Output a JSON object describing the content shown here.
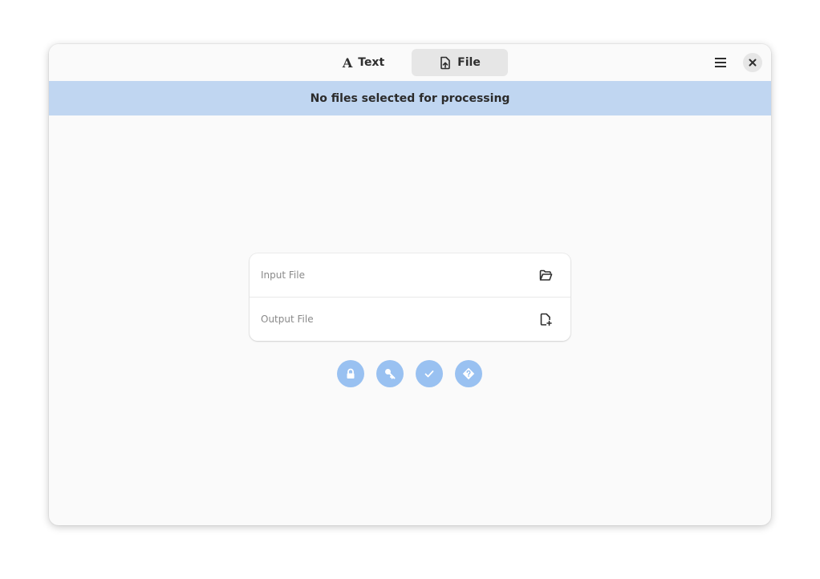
{
  "header": {
    "tabs": [
      {
        "label": "Text",
        "icon": "text-font-icon",
        "active": false
      },
      {
        "label": "File",
        "icon": "file-upload-icon",
        "active": true
      }
    ],
    "menu_icon": "hamburger-menu-icon",
    "close_icon": "close-icon"
  },
  "banner": {
    "text": "No files selected for processing",
    "color": "#c0d6f1"
  },
  "file_card": {
    "input_label": "Input File",
    "input_icon": "folder-open-icon",
    "output_label": "Output File",
    "output_icon": "document-new-icon"
  },
  "actions": [
    {
      "name": "encrypt",
      "icon": "lock-icon"
    },
    {
      "name": "decrypt",
      "icon": "key-icon"
    },
    {
      "name": "sign",
      "icon": "check-icon"
    },
    {
      "name": "verify",
      "icon": "question-diamond-icon"
    }
  ],
  "colors": {
    "accent_button": "#99c1f1",
    "window_bg": "#fafafa"
  }
}
